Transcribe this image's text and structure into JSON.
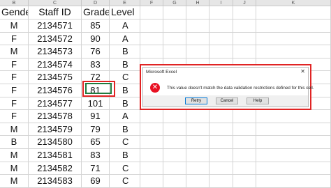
{
  "sheet": {
    "col_letters": [
      "B",
      "C",
      "D",
      "E",
      "F",
      "G",
      "H",
      "I",
      "J",
      "K"
    ],
    "headers": {
      "gender": "Gender",
      "staff_id": "Staff ID",
      "grade": "Grade",
      "level": "Level"
    },
    "rows": [
      {
        "gender": "M",
        "staff_id": "2134571",
        "grade": "85",
        "level": "A"
      },
      {
        "gender": "F",
        "staff_id": "2134572",
        "grade": "90",
        "level": "A"
      },
      {
        "gender": "M",
        "staff_id": "2134573",
        "grade": "76",
        "level": "B"
      },
      {
        "gender": "F",
        "staff_id": "2134574",
        "grade": "83",
        "level": "B"
      },
      {
        "gender": "F",
        "staff_id": "2134575",
        "grade": "72",
        "level": "C"
      },
      {
        "gender": "F",
        "staff_id": "2134576",
        "grade": "81",
        "level": "B"
      },
      {
        "gender": "F",
        "staff_id": "2134577",
        "grade": "101",
        "level": "B"
      },
      {
        "gender": "F",
        "staff_id": "2134578",
        "grade": "91",
        "level": "A"
      },
      {
        "gender": "M",
        "staff_id": "2134579",
        "grade": "79",
        "level": "B"
      },
      {
        "gender": "B",
        "staff_id": "2134580",
        "grade": "65",
        "level": "C"
      },
      {
        "gender": "M",
        "staff_id": "2134581",
        "grade": "83",
        "level": "B"
      },
      {
        "gender": "M",
        "staff_id": "2134582",
        "grade": "71",
        "level": "C"
      },
      {
        "gender": "M",
        "staff_id": "2134583",
        "grade": "69",
        "level": "C"
      }
    ]
  },
  "dialog": {
    "title": "Microsoft Excel",
    "close": "✕",
    "message": "This value doesn't match the data validation restrictions defined for this cell.",
    "buttons": {
      "retry": "Retry",
      "cancel": "Cancel",
      "help": "Help"
    },
    "icon_glyph": "✕"
  }
}
